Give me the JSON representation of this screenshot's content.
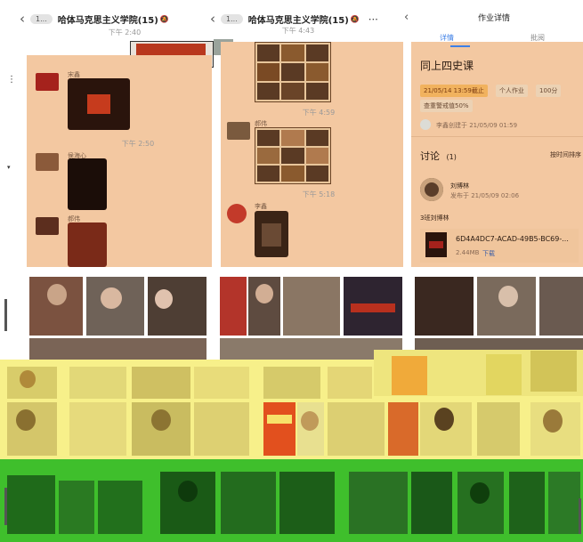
{
  "left_chat": {
    "pill": "1...",
    "title": "哈体马克思主义学院(15)",
    "times": [
      "下午 2:40",
      "下午 2:50"
    ],
    "senders": [
      "宋鑫",
      "侯海心",
      "郝伟"
    ]
  },
  "mid_chat": {
    "pill": "1...",
    "title": "哈体马克思主义学院(15)",
    "more": "⋯",
    "times": [
      "下午 4:43",
      "下午 4:59",
      "下午 5:18"
    ],
    "senders": [
      "郝伟",
      "李鑫"
    ]
  },
  "detail": {
    "back": "‹",
    "title": "作业详情",
    "tabs": [
      "详情",
      "批阅"
    ],
    "hw_title": "同上四史课",
    "deadline": "21/05/14 13:59截止",
    "type_tag": "个人作业",
    "score_tag": "100分",
    "dup_tag": "查重警戒值50%",
    "creator_line": "李鑫创建于 21/05/09 01:59",
    "discussion_label": "讨论",
    "discussion_count": "(1)",
    "sort_label": "按时间排序",
    "comment_user": "刘博林",
    "comment_time": "发布于 21/05/09 02:06",
    "comment_text": "3班刘博林",
    "file_name": "6D4A4DC7-ACAD-49B5-BC69-...",
    "file_size": "2.44MB",
    "file_action": "下载"
  },
  "colors": {
    "peach": "#f3c8a1",
    "yellow": "#f7f08a",
    "green": "#3fbf2c",
    "accent_blue": "#3d7fe6",
    "tag_orange": "#f1b25e"
  }
}
